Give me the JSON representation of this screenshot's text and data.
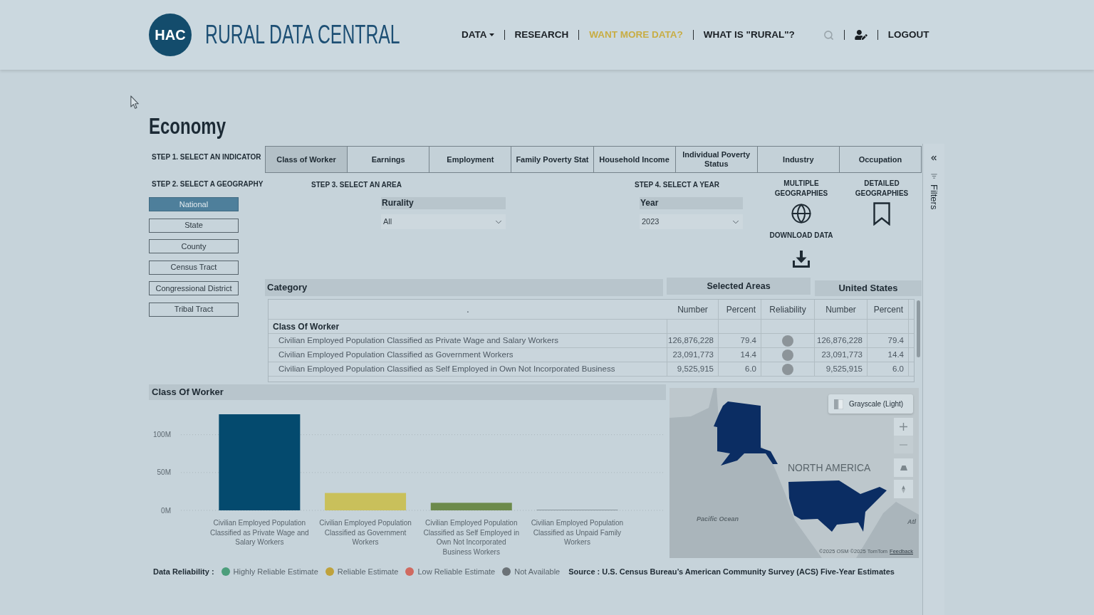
{
  "header": {
    "logo": "HAC",
    "title": "RURAL DATA CENTRAL",
    "nav": [
      {
        "kind": "menu",
        "label": "DATA",
        "highlighted": false
      },
      {
        "kind": "link",
        "label": "RESEARCH",
        "highlighted": false
      },
      {
        "kind": "link",
        "label": "WANT MORE DATA?",
        "highlighted": true
      },
      {
        "kind": "link",
        "label": "WHAT IS \"RURAL\"?",
        "highlighted": false
      },
      {
        "kind": "search"
      },
      {
        "kind": "account"
      },
      {
        "kind": "link",
        "label": "LOGOUT",
        "highlighted": false
      }
    ]
  },
  "page_title": "Economy",
  "indicator": {
    "step": "STEP 1. SELECT AN INDICATOR",
    "tabs": [
      {
        "label": "Class of Worker",
        "selected": true
      },
      {
        "label": "Earnings",
        "selected": false
      },
      {
        "label": "Employment",
        "selected": false
      },
      {
        "label": "Family Poverty Stat",
        "selected": false
      },
      {
        "label": "Household Income",
        "selected": false
      },
      {
        "label": "Individual Poverty Status",
        "selected": false
      },
      {
        "label": "Industry",
        "selected": false
      },
      {
        "label": "Occupation",
        "selected": false
      }
    ]
  },
  "geography": {
    "step": "STEP 2. SELECT A GEOGRAPHY",
    "options": [
      {
        "label": "National",
        "selected": true
      },
      {
        "label": "State",
        "selected": false
      },
      {
        "label": "County",
        "selected": false
      },
      {
        "label": "Census Tract",
        "selected": false
      },
      {
        "label": "Congressional District",
        "selected": false
      },
      {
        "label": "Tribal Tract",
        "selected": false
      }
    ]
  },
  "area": {
    "step": "STEP 3. SELECT AN AREA",
    "field": {
      "label": "Rurality",
      "value": "All"
    }
  },
  "year": {
    "step": "STEP 4. SELECT A YEAR",
    "field": {
      "label": "Year",
      "value": "2023"
    }
  },
  "tool_columns": [
    {
      "items": [
        {
          "kind": "globe",
          "label": "MULTIPLE GEOGRAPHIES"
        },
        {
          "kind": "download",
          "label": "DOWNLOAD DATA"
        }
      ]
    },
    {
      "items": [
        {
          "kind": "bookmark",
          "label": "DETAILED GEOGRAPHIES"
        }
      ]
    }
  ],
  "table": {
    "headers": [
      "Category",
      "Selected Areas",
      "United States"
    ],
    "columns": [
      ".",
      "Number",
      "Percent",
      "Reliability",
      "Number",
      "Percent"
    ],
    "group": "Class Of Worker",
    "rows": [
      {
        "category": "Civilian Employed Population Classified as Private Wage and Salary Workers",
        "number": "126,876,228",
        "percent": "79.4",
        "color": "#8c9499",
        "us_number": "126,876,228",
        "us_percent": "79.4"
      },
      {
        "category": "Civilian Employed Population Classified as Government Workers",
        "number": "23,091,773",
        "percent": "14.4",
        "color": "#8c9499",
        "us_number": "23,091,773",
        "us_percent": "14.4"
      },
      {
        "category": "Civilian Employed Population Classified as Self Employed in Own Not Incorporated Business",
        "number": "9,525,915",
        "percent": "6.0",
        "color": "#8c9499",
        "us_number": "9,525,915",
        "us_percent": "6.0"
      }
    ]
  },
  "chart": {
    "chart_data": {
      "type": "bar",
      "title": "Class Of Worker",
      "categories": [
        "Civilian Employed Population Classified as Private Wage and Salary Workers",
        "Civilian Employed Population Classified as Government Workers",
        "Civilian Employed Population Classified as Self Employed in Own Not Incorporated Business Workers",
        "Civilian Employed Population Classified as Unpaid Family Workers"
      ],
      "series": [
        {
          "values": [
            127,
            23,
            10,
            0
          ],
          "colors": [
            "#044a6e",
            "#c9c05b",
            "#6c8a4b",
            "#8a979e"
          ]
        }
      ],
      "ylim": [
        0,
        127
      ],
      "yticks": [
        {
          "value": 0,
          "label": "0M"
        },
        {
          "value": 50,
          "label": "50M"
        },
        {
          "value": 100,
          "label": "100M"
        }
      ]
    }
  },
  "map": {
    "style_button": "Grayscale (Light)",
    "labels": [
      {
        "kind": "region",
        "text": "NORTH AMERICA"
      },
      {
        "kind": "water",
        "text": "Pacific Ocean"
      },
      {
        "kind": "water",
        "text": "Atl"
      }
    ],
    "attribution": "©2025 OSM ©2025 TomTom",
    "feedback_link": "Feedback"
  },
  "reliability_legend": {
    "title": "Data Reliability :",
    "items": [
      {
        "label": "Highly Reliable Estimate",
        "color": "#4c9e7b"
      },
      {
        "label": "Reliable Estimate",
        "color": "#bfa23c"
      },
      {
        "label": "Low Reliable Estimate",
        "color": "#d06a60"
      },
      {
        "label": "Not Available",
        "color": "#6b7277"
      }
    ]
  },
  "source": "Source : U.S. Census Bureau’s American Community Survey (ACS) Five-Year Estimates",
  "filters_pane": {
    "label": "Filters"
  }
}
